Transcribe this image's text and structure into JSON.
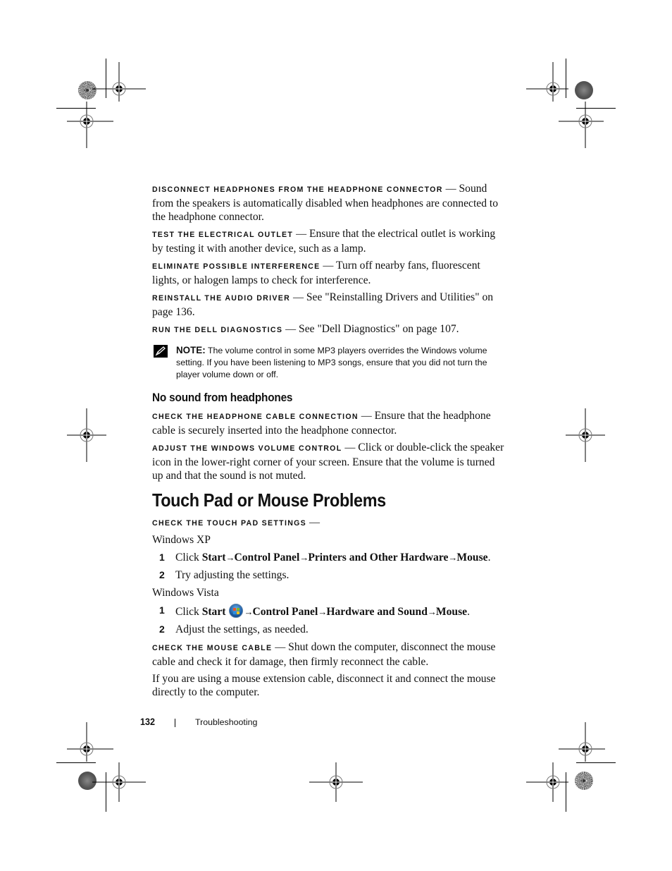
{
  "sections": [
    {
      "items": [
        {
          "heading": "Disconnect headphones from the headphone connector",
          "text": "Sound from the speakers is automatically disabled when headphones are connected to the headphone connector."
        },
        {
          "heading": "Test the electrical outlet",
          "text": "Ensure that the electrical outlet is working by testing it with another device, such as a lamp."
        },
        {
          "heading": "Eliminate possible interference",
          "text": "Turn off nearby fans, fluorescent lights, or halogen lamps to check for interference."
        },
        {
          "heading": "Reinstall the audio driver",
          "text": "See \"Reinstalling Drivers and Utilities\" on page 136."
        },
        {
          "heading": "Run the Dell Diagnostics",
          "text": "See \"Dell Diagnostics\" on page 107."
        }
      ]
    }
  ],
  "note": {
    "icon": "pencil-note-icon",
    "label": "NOTE:",
    "text": "The volume control in some MP3 players overrides the Windows volume setting. If you have been listening to MP3 songs, ensure that you did not turn the player volume down or off."
  },
  "no_sound_headphones": {
    "title": "No sound from headphones",
    "items": [
      {
        "heading": "Check the headphone cable connection",
        "text": "Ensure that the headphone cable is securely inserted into the headphone connector."
      },
      {
        "heading": "Adjust the Windows volume control",
        "text": "Click or double-click the speaker icon in the lower-right corner of your screen. Ensure that the volume is turned up and that the sound is not muted."
      }
    ]
  },
  "touch_pad": {
    "title": "Touch Pad or Mouse Problems",
    "check_settings_heading": "Check the touch pad settings",
    "xp": {
      "label": "Windows XP",
      "steps": [
        {
          "num": "1",
          "prefix": "Click ",
          "path": [
            "Start",
            "Control Panel",
            "Printers and Other Hardware",
            "Mouse"
          ],
          "suffix": "."
        },
        {
          "num": "2",
          "text": "Try adjusting the settings."
        }
      ]
    },
    "vista": {
      "label": "Windows Vista",
      "steps": [
        {
          "num": "1",
          "prefix": "Click ",
          "start": "Start",
          "start_icon": "windows-start-orb-icon",
          "path": [
            "Control Panel",
            "Hardware and Sound",
            "Mouse"
          ],
          "suffix": "."
        },
        {
          "num": "2",
          "text": "Adjust the settings, as needed."
        }
      ]
    },
    "mouse_cable": {
      "heading": "Check the mouse cable",
      "text": "Shut down the computer, disconnect the mouse cable and check it for damage, then firmly reconnect the cable."
    },
    "extension_text": "If you are using a mouse extension cable, disconnect it and connect the mouse directly to the computer."
  },
  "arrow": "→",
  "dash": "—",
  "footer": {
    "page_number": "132",
    "section": "Troubleshooting"
  }
}
